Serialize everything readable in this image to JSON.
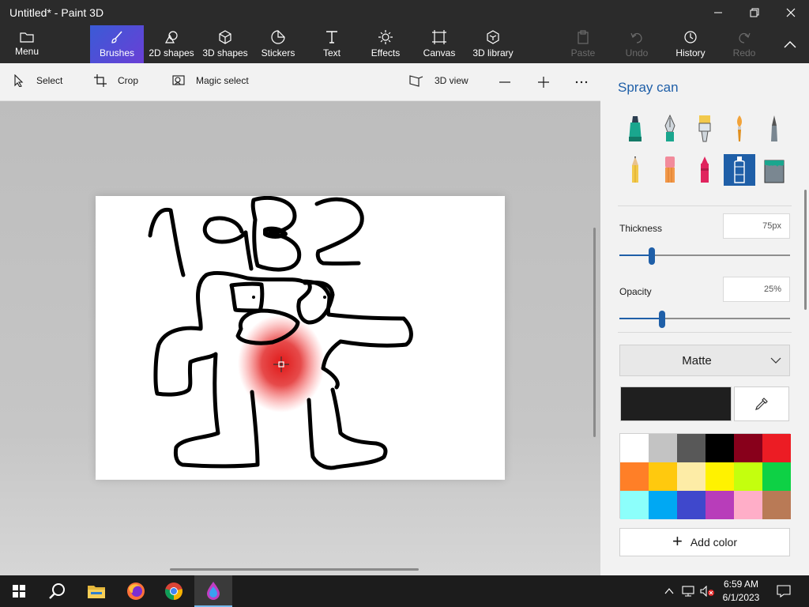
{
  "window": {
    "title": "Untitled* - Paint 3D",
    "minimize_icon": "minimize-icon",
    "maximize_icon": "restore-icon",
    "close_icon": "close-icon"
  },
  "ribbon": {
    "menu": "Menu",
    "tools": [
      {
        "label": "Brushes",
        "icon": "brush-icon",
        "active": true
      },
      {
        "label": "2D shapes",
        "icon": "2d-shapes-icon"
      },
      {
        "label": "3D shapes",
        "icon": "3d-shapes-icon"
      },
      {
        "label": "Stickers",
        "icon": "stickers-icon"
      },
      {
        "label": "Text",
        "icon": "text-icon"
      },
      {
        "label": "Effects",
        "icon": "effects-icon"
      },
      {
        "label": "Canvas",
        "icon": "canvas-icon"
      },
      {
        "label": "3D library",
        "icon": "3d-library-icon"
      }
    ],
    "actions": [
      {
        "label": "Paste",
        "icon": "paste-icon",
        "disabled": true
      },
      {
        "label": "Undo",
        "icon": "undo-icon",
        "disabled": true
      },
      {
        "label": "History",
        "icon": "history-icon",
        "disabled": false
      },
      {
        "label": "Redo",
        "icon": "redo-icon",
        "disabled": true
      }
    ],
    "accent_gradient": [
      "#3a5bd6",
      "#6a3fd6"
    ]
  },
  "commandbar": {
    "select": "Select",
    "crop": "Crop",
    "magic_select": "Magic select",
    "view_3d": "3D view",
    "zoom_out_icon": "minus-icon",
    "zoom_in_icon": "plus-icon",
    "more_icon": "ellipsis-icon"
  },
  "panel": {
    "title": "Spray can",
    "brushes": [
      "marker",
      "calligraphy-pen",
      "oil-brush",
      "watercolor",
      "pixel-pen",
      "pencil",
      "eraser",
      "crayon",
      "spray-can",
      "fill"
    ],
    "selected_brush": "spray-can",
    "thickness": {
      "label": "Thickness",
      "value": "75px",
      "level": 0.19
    },
    "opacity": {
      "label": "Opacity",
      "value": "25%",
      "level": 0.25
    },
    "finish": {
      "selected": "Matte"
    },
    "current_color": "#1f1f1f",
    "palette": [
      "#ffffff",
      "#c3c3c3",
      "#585858",
      "#000000",
      "#88001b",
      "#ec1c24",
      "#ff7f27",
      "#ffc90e",
      "#fdeca6",
      "#fff200",
      "#c4ff0e",
      "#0ed145",
      "#8cfffb",
      "#00a8f3",
      "#3f48cc",
      "#b83dba",
      "#ffaec8",
      "#b97a56"
    ],
    "add_color": "Add color",
    "accent": "#1f5fa8"
  },
  "taskbar": {
    "apps": [
      "start-icon",
      "search-icon",
      "file-explorer-icon",
      "firefox-icon",
      "chrome-icon",
      "paint-3d-icon"
    ],
    "time": "6:59 AM",
    "date": "6/1/2023",
    "tray_icons": [
      "chevron-up-icon",
      "network-icon",
      "volume-muted-icon",
      "notifications-icon"
    ]
  }
}
